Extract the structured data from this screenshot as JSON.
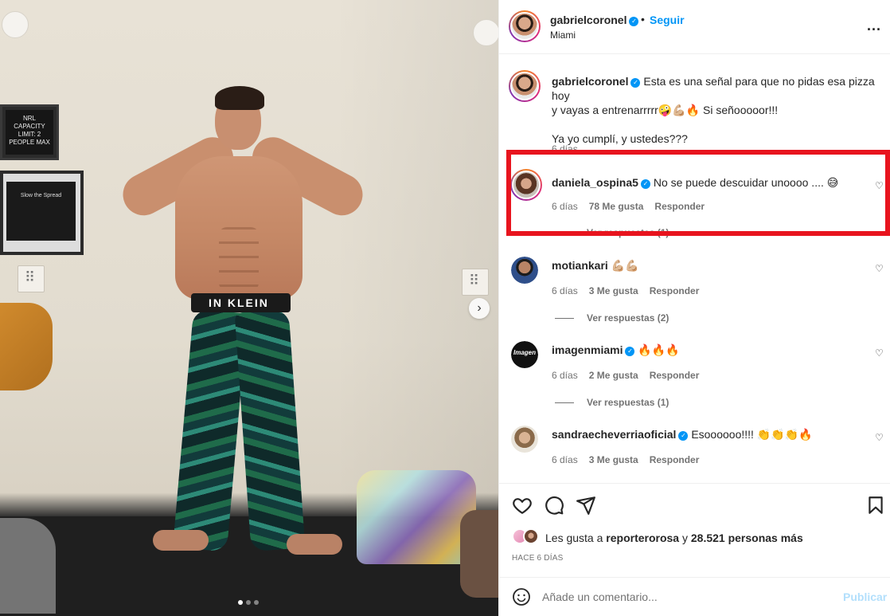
{
  "photo": {
    "sign_capacity": "NRL CAPACITY LIMIT: 2 PEOPLE MAX",
    "sign_spread": "Slow the Spread",
    "waistband": "IN KLEIN",
    "carousel_dots": 3,
    "active_dot": 1
  },
  "post": {
    "author": "gabrielcoronel",
    "follow_label": "Seguir",
    "location": "Miami",
    "more_label": "...",
    "caption_user": "gabrielcoronel",
    "caption_line1": "Esta es una señal para que no pidas esa pizza hoy",
    "caption_line2": "y vayas a entrenarrrrr🤪💪🏼🔥 Si señooooor!!!",
    "caption_line3": "Ya yo cumplí, y ustedes???",
    "caption_time": "6 días"
  },
  "comments": [
    {
      "user": "daniela_ospina5",
      "verified": true,
      "text": "No se puede descuidar unoooo .... 😅",
      "time": "6 días",
      "likes": "78 Me gusta",
      "reply": "Responder",
      "replies": "Ver respuestas (1)"
    },
    {
      "user": "motiankari",
      "verified": false,
      "text": "💪🏼💪🏼",
      "time": "6 días",
      "likes": "3 Me gusta",
      "reply": "Responder",
      "replies": "Ver respuestas (2)"
    },
    {
      "user": "imagenmiami",
      "verified": true,
      "text": "🔥🔥🔥",
      "time": "6 días",
      "likes": "2 Me gusta",
      "reply": "Responder",
      "replies": "Ver respuestas (1)"
    },
    {
      "user": "sandraecheverriaoficial",
      "verified": true,
      "text": "Esoooooo!!!! 👏👏👏🔥",
      "time": "6 días",
      "likes": "3 Me gusta",
      "reply": "Responder"
    }
  ],
  "avatar_text": {
    "imagenmiami": "Imagen"
  },
  "footer": {
    "likes_prefix": "Les gusta a",
    "likes_user": "reporterorosa",
    "likes_conj": "y",
    "likes_count": "28.521 personas más",
    "date": "HACE 6 DÍAS",
    "comment_placeholder": "Añade un comentario...",
    "publish_label": "Publicar"
  },
  "colors": {
    "accent": "#0095f6",
    "highlight": "#e8141e",
    "text": "#262626",
    "muted": "#737373"
  }
}
